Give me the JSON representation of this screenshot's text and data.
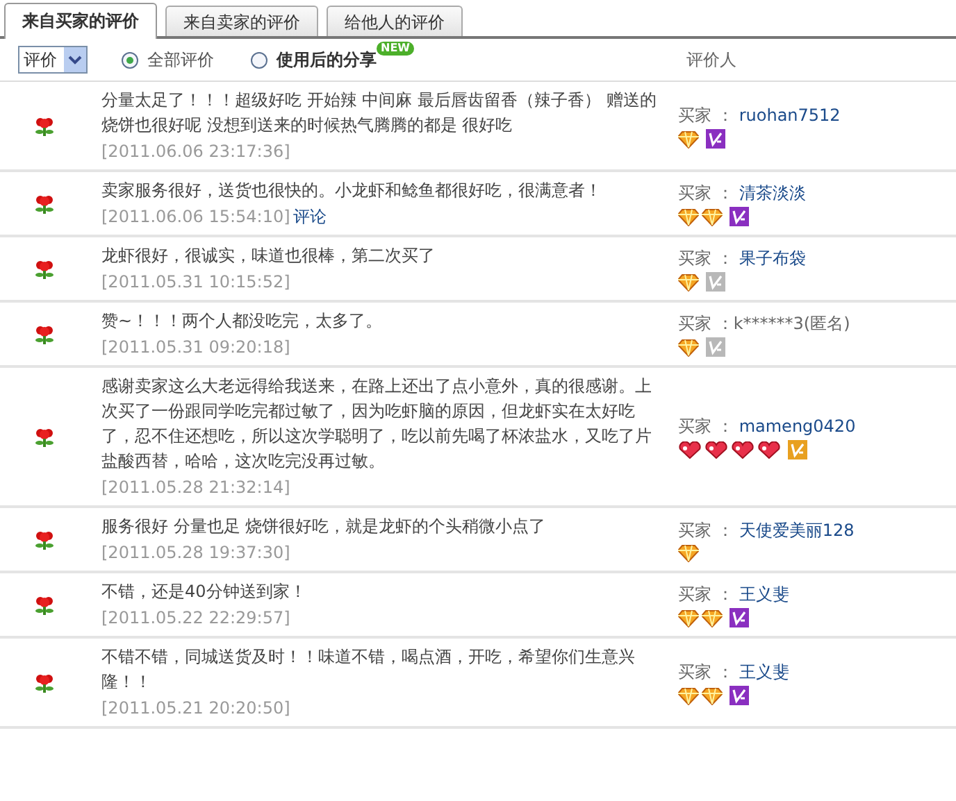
{
  "tabs": [
    {
      "label": "来自买家的评价",
      "selected": true
    },
    {
      "label": "来自卖家的评价",
      "selected": false
    },
    {
      "label": "给他人的评价",
      "selected": false
    }
  ],
  "filter": {
    "select": "评价",
    "radios": [
      {
        "label": "全部评价",
        "selected": true,
        "bold": false
      },
      {
        "label": "使用后的分享",
        "selected": false,
        "bold": true,
        "badge": "NEW"
      }
    ],
    "reviewer_heading": "评价人"
  },
  "reviews": [
    {
      "comment": "分量太足了！！！超级好吃 开始辣 中间麻 最后唇齿留香（辣子香） 赠送的烧饼也很好呢 没想到送来的时候热气腾腾的都是 很好吃",
      "time": "[2011.06.06 23:17:36]",
      "role": "买家 ：",
      "buyer": "ruohan7512",
      "anonymous": false,
      "badges": [
        {
          "kind": "diamond"
        },
        {
          "kind": "vip",
          "color": "#8a2fc0"
        }
      ]
    },
    {
      "comment": "卖家服务很好，送货也很快的。小龙虾和鲶鱼都很好吃，很满意者！",
      "time": "[2011.06.06 15:54:10]",
      "reply": "评论",
      "role": "买家 ：",
      "buyer": "清茶淡淡",
      "anonymous": false,
      "badges": [
        {
          "kind": "diamond"
        },
        {
          "kind": "diamond"
        },
        {
          "kind": "vip",
          "color": "#8a2fc0"
        }
      ]
    },
    {
      "comment": "龙虾很好，很诚实，味道也很棒，第二次买了",
      "time": "[2011.05.31 10:15:52]",
      "role": "买家 ：",
      "buyer": "果子布袋",
      "anonymous": false,
      "badges": [
        {
          "kind": "diamond"
        },
        {
          "kind": "vip",
          "color": "#b8b8b8"
        }
      ]
    },
    {
      "comment": "赞~！！！两个人都没吃完，太多了。",
      "time": "[2011.05.31 09:20:18]",
      "role": "买家 ：",
      "buyer": "k******3(匿名)",
      "anonymous": true,
      "badges": [
        {
          "kind": "diamond"
        },
        {
          "kind": "vip",
          "color": "#b8b8b8"
        }
      ]
    },
    {
      "comment": "感谢卖家这么大老远得给我送来，在路上还出了点小意外，真的很感谢。上次买了一份跟同学吃完都过敏了，因为吃虾脑的原因，但龙虾实在太好吃了，忍不住还想吃，所以这次学聪明了，吃以前先喝了杯浓盐水，又吃了片盐酸西替，哈哈，这次吃完没再过敏。",
      "time": "[2011.05.28 21:32:14]",
      "role": "买家 ：",
      "buyer": "mameng0420",
      "anonymous": false,
      "badges": [
        {
          "kind": "heart"
        },
        {
          "kind": "heart"
        },
        {
          "kind": "heart"
        },
        {
          "kind": "heart"
        },
        {
          "kind": "vip",
          "color": "#e8a020"
        }
      ]
    },
    {
      "comment": "服务很好 分量也足 烧饼很好吃，就是龙虾的个头稍微小点了",
      "time": "[2011.05.28 19:37:30]",
      "role": "买家 ：",
      "buyer": "天使爱美丽128",
      "anonymous": false,
      "badges": [
        {
          "kind": "diamond"
        }
      ]
    },
    {
      "comment": "不错，还是40分钟送到家！",
      "time": "[2011.05.22 22:29:57]",
      "role": "买家 ：",
      "buyer": "王义斐",
      "anonymous": false,
      "badges": [
        {
          "kind": "diamond"
        },
        {
          "kind": "diamond"
        },
        {
          "kind": "vip",
          "color": "#8a2fc0"
        }
      ]
    },
    {
      "comment": "不错不错，同城送货及时！！味道不错，喝点酒，开吃，希望你们生意兴隆！！",
      "time": "[2011.05.21 20:20:50]",
      "role": "买家 ：",
      "buyer": "王义斐",
      "anonymous": false,
      "badges": [
        {
          "kind": "diamond"
        },
        {
          "kind": "diamond"
        },
        {
          "kind": "vip",
          "color": "#8a2fc0"
        }
      ]
    }
  ]
}
